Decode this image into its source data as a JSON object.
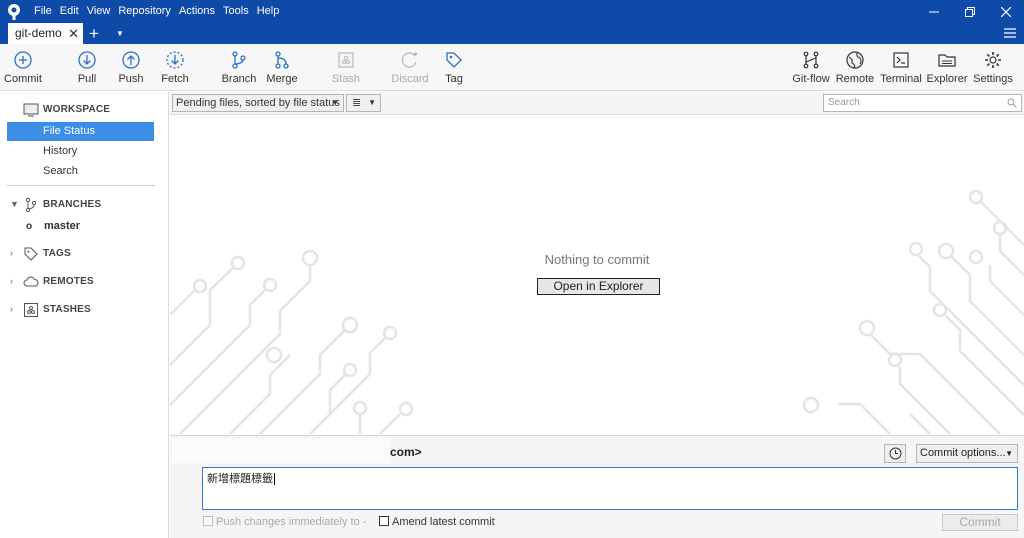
{
  "menu": [
    "File",
    "Edit",
    "View",
    "Repository",
    "Actions",
    "Tools",
    "Help"
  ],
  "tab": {
    "label": "git-demo"
  },
  "toolbar": {
    "commit": "Commit",
    "pull": "Pull",
    "push": "Push",
    "fetch": "Fetch",
    "branch": "Branch",
    "merge": "Merge",
    "stash": "Stash",
    "discard": "Discard",
    "tag": "Tag",
    "gitflow": "Git-flow",
    "remote": "Remote",
    "terminal": "Terminal",
    "explorer": "Explorer",
    "settings": "Settings"
  },
  "sidebar": {
    "workspace": "WORKSPACE",
    "file_status": "File Status",
    "history": "History",
    "search": "Search",
    "branches": "BRANCHES",
    "branch_master": "master",
    "tags": "TAGS",
    "remotes": "REMOTES",
    "stashes": "STASHES"
  },
  "filter": {
    "sort_label": "Pending files, sorted by file status",
    "search_placeholder": "Search"
  },
  "main": {
    "empty_message": "Nothing to commit",
    "open_explorer": "Open in Explorer"
  },
  "commit": {
    "author_suffix": "com>",
    "options_label": "Commit options...",
    "message": "新增標題標籤",
    "push_label": "Push changes immediately to -",
    "amend_label": "Amend latest commit",
    "commit_button": "Commit"
  },
  "colors": {
    "titlebar": "#0e4aa8",
    "selection": "#3d8ee6"
  }
}
